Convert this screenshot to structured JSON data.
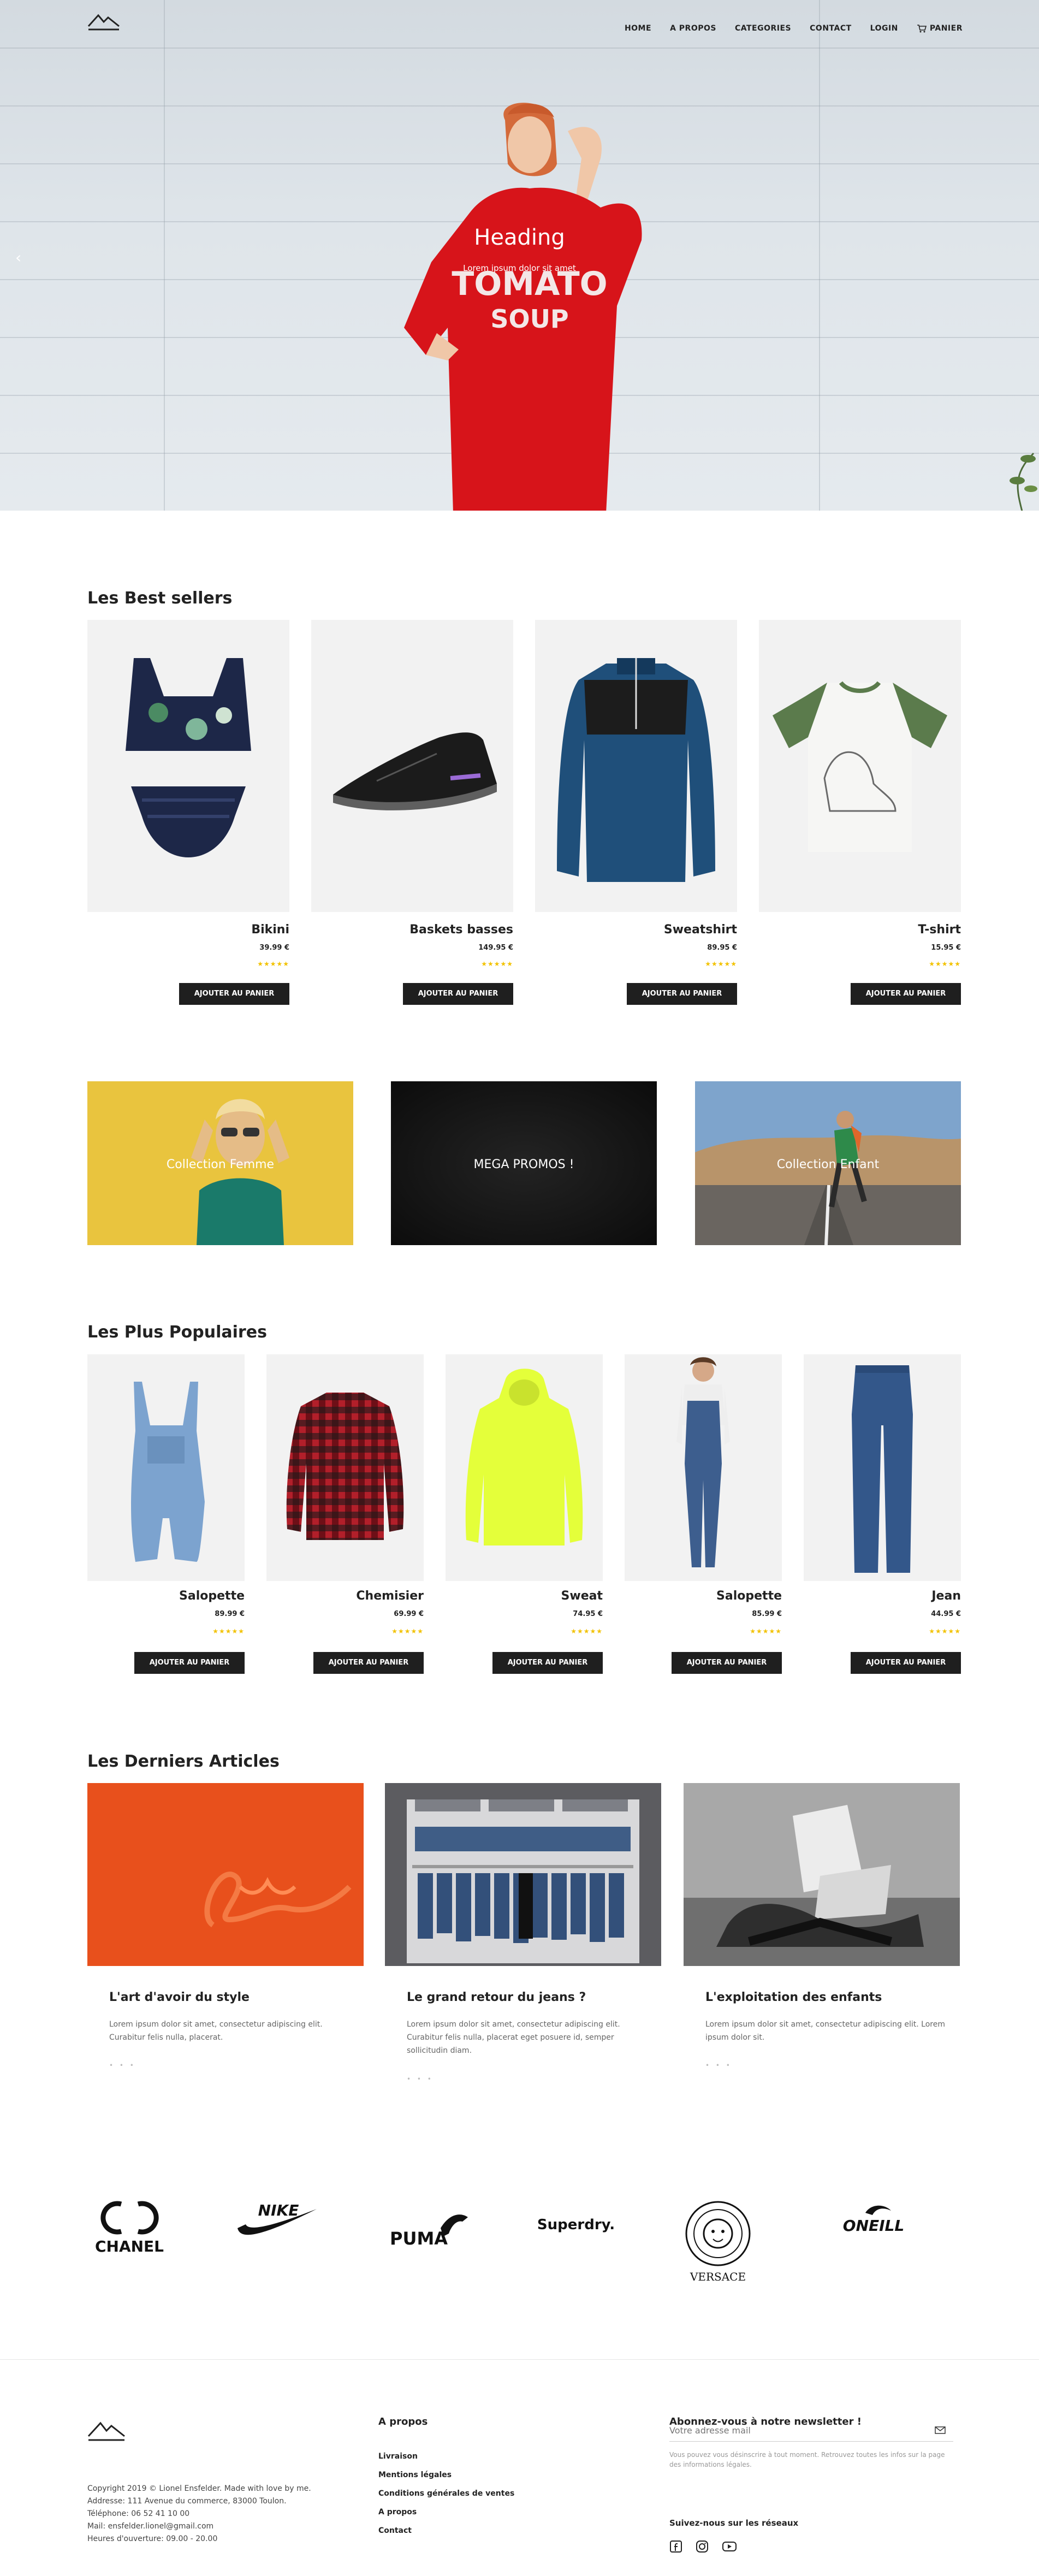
{
  "nav": {
    "links": [
      "HOME",
      "A PROPOS",
      "CATEGORIES",
      "CONTACT",
      "LOGIN"
    ],
    "cart_label": "PANIER"
  },
  "hero": {
    "heading": "Heading",
    "subtext": "Lorem ipsum dolor sit amet"
  },
  "best_sellers": {
    "title": "Les Best sellers",
    "add_label": "AJOUTER AU PANIER",
    "products": [
      {
        "name": "Bikini",
        "price": "39.99 €",
        "rating": 4.5
      },
      {
        "name": "Baskets basses",
        "price": "149.95 €",
        "rating": 4.5
      },
      {
        "name": "Sweatshirt",
        "price": "89.95 €",
        "rating": 4.5
      },
      {
        "name": "T-shirt",
        "price": "15.95 €",
        "rating": 4.5
      }
    ]
  },
  "collections": [
    "Collection Femme",
    "MEGA PROMOS !",
    "Collection Enfant"
  ],
  "popular": {
    "title": "Les Plus Populaires",
    "add_label": "AJOUTER AU PANIER",
    "products": [
      {
        "name": "Salopette",
        "price": "89.99 €",
        "rating": 4.5
      },
      {
        "name": "Chemisier",
        "price": "69.99 €",
        "rating": 4.5
      },
      {
        "name": "Sweat",
        "price": "74.95 €",
        "rating": 4.5
      },
      {
        "name": "Salopette",
        "price": "85.99 €",
        "rating": 4.5
      },
      {
        "name": "Jean",
        "price": "44.95 €",
        "rating": 4.5
      }
    ]
  },
  "articles": {
    "title": "Les Derniers Articles",
    "items": [
      {
        "title": "L'art d'avoir du style",
        "text": "Lorem ipsum dolor sit amet, consectetur adipiscing elit. Curabitur felis nulla, placerat."
      },
      {
        "title": "Le grand retour du jeans ?",
        "text": "Lorem ipsum dolor sit amet, consectetur adipiscing elit. Curabitur felis nulla, placerat eget posuere id, semper sollicitudin diam."
      },
      {
        "title": "L'exploitation des enfants",
        "text": "Lorem ipsum dolor sit amet, consectetur adipiscing elit. Lorem ipsum dolor sit."
      }
    ],
    "dots": "• • •"
  },
  "brands": [
    "CHANEL",
    "NIKE",
    "PUMA",
    "Superdry.",
    "VERSACE",
    "ONEILL"
  ],
  "footer": {
    "copyright": "Copyright 2019 © Lionel Ensfelder. Made with love by me.",
    "address": "Addresse: 111 Avenue du commerce, 83000 Toulon.",
    "phone": "Téléphone: 06 52 41 10 00",
    "mail": "Mail: ensfelder.lionel@gmail.com",
    "hours": "Heures d'ouverture: 09.00 - 20.00",
    "about_title": "A propos",
    "about_links": [
      "Livraison",
      "Mentions légales",
      "Conditions générales de ventes",
      "A propos",
      "Contact"
    ],
    "newsletter_title": "Abonnez-vous à notre newsletter !",
    "newsletter_placeholder": "Votre adresse mail",
    "newsletter_note": "Vous pouvez vous désinscrire à tout moment. Retrouvez toutes les infos sur la page des informations légales.",
    "social_title": "Suivez-nous sur les réseaux"
  }
}
